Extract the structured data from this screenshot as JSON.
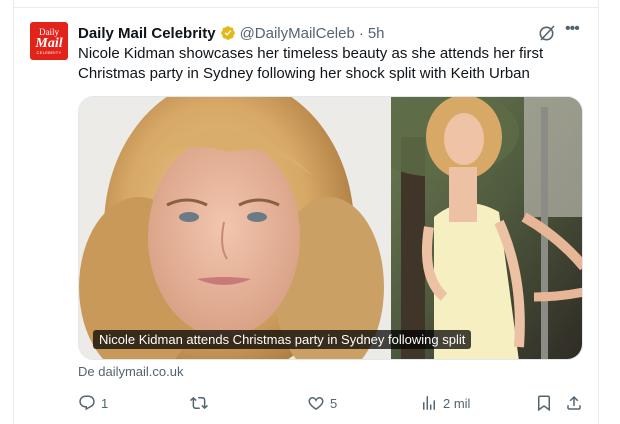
{
  "tweet": {
    "author_name": "Daily Mail Celebrity",
    "author_handle": "@DailyMailCeleb",
    "separator": "·",
    "time": "5h",
    "text": "Nicole Kidman showcases her timeless beauty as she attends her first Christmas party in Sydney following her shock split with Keith Urban",
    "avatar": {
      "line1": "Daily",
      "line2": "Mail",
      "line3": "CELEBRITY"
    },
    "media_caption": "Nicole Kidman attends Christmas party in Sydney following split",
    "source": "De dailymail.co.uk"
  },
  "actions": {
    "replies": "1",
    "retweets": "",
    "likes": "5",
    "views": "2 mil"
  },
  "icons": {
    "verified": "verified-badge-icon",
    "grok": "grok-icon",
    "more": "more-icon",
    "reply": "reply-icon",
    "retweet": "retweet-icon",
    "like": "heart-icon",
    "views": "views-icon",
    "bookmark": "bookmark-icon",
    "share": "share-icon"
  },
  "colors": {
    "text": "#0f1419",
    "muted": "#536471",
    "brand": "#e2231a",
    "verified": "#e2b719"
  }
}
